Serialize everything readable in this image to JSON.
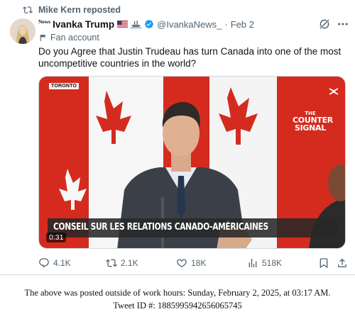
{
  "repost": {
    "text": "Mike Kern reposted",
    "icon": "repost-icon"
  },
  "author": {
    "news_tag": "News",
    "display_name": "Ivanka Trump",
    "handle": "@IvankaNews_",
    "separator": "·",
    "date": "Feb 2",
    "badges": [
      "us-flag-icon",
      "ship-icon",
      "verified-badge-icon"
    ],
    "label": "Fan account",
    "label_icon": "fan-account-icon"
  },
  "tweet": {
    "text": "Do you Agree that Justin Trudeau has turn Canada into one of the most uncompetitive countries in the world?"
  },
  "media": {
    "location_tag": "TORONTO",
    "brand_small": "THE",
    "brand_line1": "COUNTER",
    "brand_line2": "SIGNAL",
    "caption": "CONSEIL SUR LES RELATIONS CANADO-AMÉRICAINES",
    "duration": "0:31"
  },
  "actions": {
    "replies": "4.1K",
    "reposts": "2.1K",
    "likes": "18K",
    "views": "518K"
  },
  "footer": {
    "line1": "The above was posted outside of work hours: Sunday, February 2, 2025, at 03:17 AM.",
    "line2": "Tweet ID #: 1885995942656065745"
  },
  "colors": {
    "secondary_text": "#536471",
    "verified_blue": "#1d9bf0",
    "flag_red": "#d52b1e"
  }
}
